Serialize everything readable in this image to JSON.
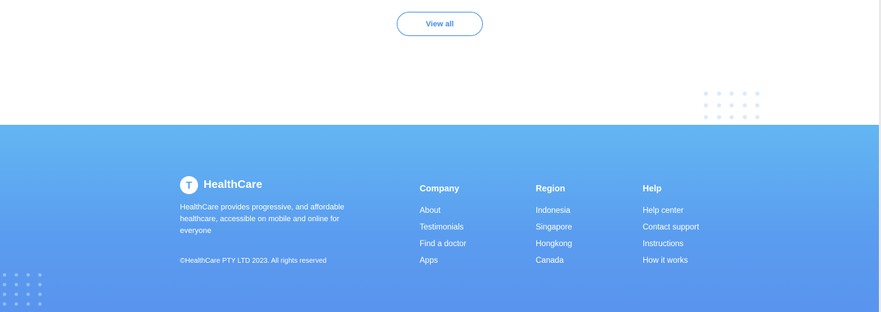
{
  "section": {
    "view_all_label": "View all"
  },
  "footer": {
    "brand": {
      "logo_letter": "T",
      "name": "HealthCare",
      "description": "HealthCare provides progressive, and affordable healthcare, accessible on mobile and online for everyone",
      "copyright": "©HealthCare PTY LTD 2023. All rights reserved"
    },
    "columns": [
      {
        "heading": "Company",
        "links": [
          "About",
          "Testimonials",
          "Find a doctor",
          "Apps"
        ]
      },
      {
        "heading": "Region",
        "links": [
          "Indonesia",
          "Singapore",
          "Hongkong",
          "Canada"
        ]
      },
      {
        "heading": "Help",
        "links": [
          "Help center",
          "Contact support",
          "Instructions",
          "How it works"
        ]
      }
    ]
  },
  "colors": {
    "accent": "#3f8fe6",
    "footer_gradient_top": "#63b6f3",
    "footer_gradient_bottom": "#5994ee"
  }
}
